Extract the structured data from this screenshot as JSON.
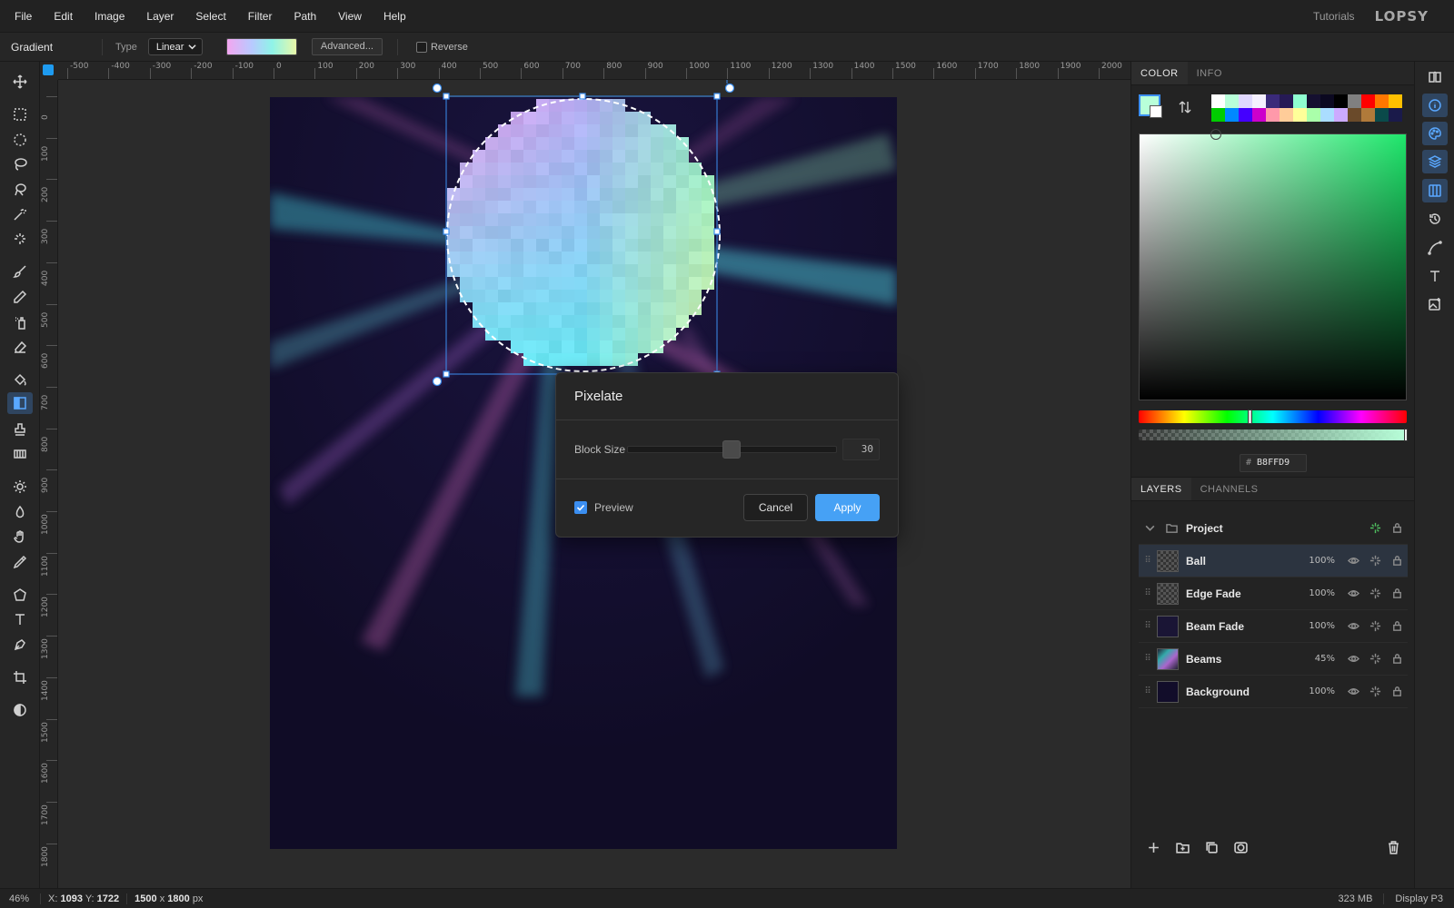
{
  "menu": [
    "File",
    "Edit",
    "Image",
    "Layer",
    "Select",
    "Filter",
    "Path",
    "View",
    "Help"
  ],
  "header": {
    "tutorials": "Tutorials",
    "logo": "LOPSY"
  },
  "options": {
    "tool_name": "Gradient",
    "type_label": "Type",
    "type_value": "Linear",
    "advanced_label": "Advanced...",
    "reverse_label": "Reverse"
  },
  "ruler_top": [
    "-500",
    "-400",
    "-300",
    "-200",
    "-100",
    "0",
    "100",
    "200",
    "300",
    "400",
    "500",
    "600",
    "700",
    "800",
    "900",
    "1000",
    "1100",
    "1200",
    "1300",
    "1400",
    "1500",
    "1600",
    "1700",
    "1800",
    "1900",
    "2000"
  ],
  "ruler_left": [
    "0",
    "100",
    "200",
    "300",
    "400",
    "500",
    "600",
    "700",
    "800",
    "900",
    "1000",
    "1100",
    "1200",
    "1300",
    "1400",
    "1500",
    "1600",
    "1700",
    "1800"
  ],
  "tools": [
    "move-icon",
    "rect-select-icon",
    "ellipse-select-icon",
    "lasso-icon",
    "magic-lasso-icon",
    "magic-wand-icon",
    "quick-select-icon",
    "brush-icon",
    "pencil-icon",
    "spray-icon",
    "eraser-icon",
    "fill-bucket-icon",
    "gradient-icon",
    "stamp-icon",
    "pattern-icon",
    "dodge-icon",
    "burn-icon",
    "hand-icon",
    "eyedropper-icon",
    "polygon-icon",
    "text-icon",
    "pen-icon",
    "crop-icon",
    "contrast-icon"
  ],
  "dialog": {
    "title": "Pixelate",
    "block_size_label": "Block Size",
    "block_size_value": "30",
    "preview_label": "Preview",
    "cancel_label": "Cancel",
    "apply_label": "Apply"
  },
  "color_panel": {
    "tabs": [
      "COLOR",
      "INFO"
    ],
    "foreground": "#b8ffd9",
    "hex_value": "B8FFD9",
    "swatches": [
      "#ffffff",
      "#b8ffd9",
      "#e0d8ff",
      "#f5f0ff",
      "#3a2a7a",
      "#261a55",
      "#8fffd0",
      "#151030",
      "#0b0820",
      "#000000",
      "#808080",
      "#ff0000",
      "#ff7700",
      "#ffc000",
      "#00cc00",
      "#0088ff",
      "#4400ff",
      "#cc00cc",
      "#ff99aa",
      "#ffcc99",
      "#ffff99",
      "#aaffaa",
      "#aaddff",
      "#ccaaff",
      "#6a4a2a",
      "#b07a3a",
      "#0a4a4a",
      "#1a1a4a"
    ]
  },
  "layers_panel": {
    "tabs": [
      "LAYERS",
      "CHANNELS"
    ],
    "group_name": "Project",
    "layers": [
      {
        "name": "Ball",
        "opacity": "100%"
      },
      {
        "name": "Edge Fade",
        "opacity": "100%"
      },
      {
        "name": "Beam Fade",
        "opacity": "100%"
      },
      {
        "name": "Beams",
        "opacity": "45%"
      },
      {
        "name": "Background",
        "opacity": "100%"
      }
    ]
  },
  "status": {
    "zoom": "46%",
    "x_label": "X:",
    "x_value": "1093",
    "y_label": "Y:",
    "y_value": "1722",
    "doc_w": "1500",
    "doc_x": "x",
    "doc_h": "1800",
    "doc_unit": "px",
    "memory": "323 MB",
    "display": "Display P3"
  }
}
